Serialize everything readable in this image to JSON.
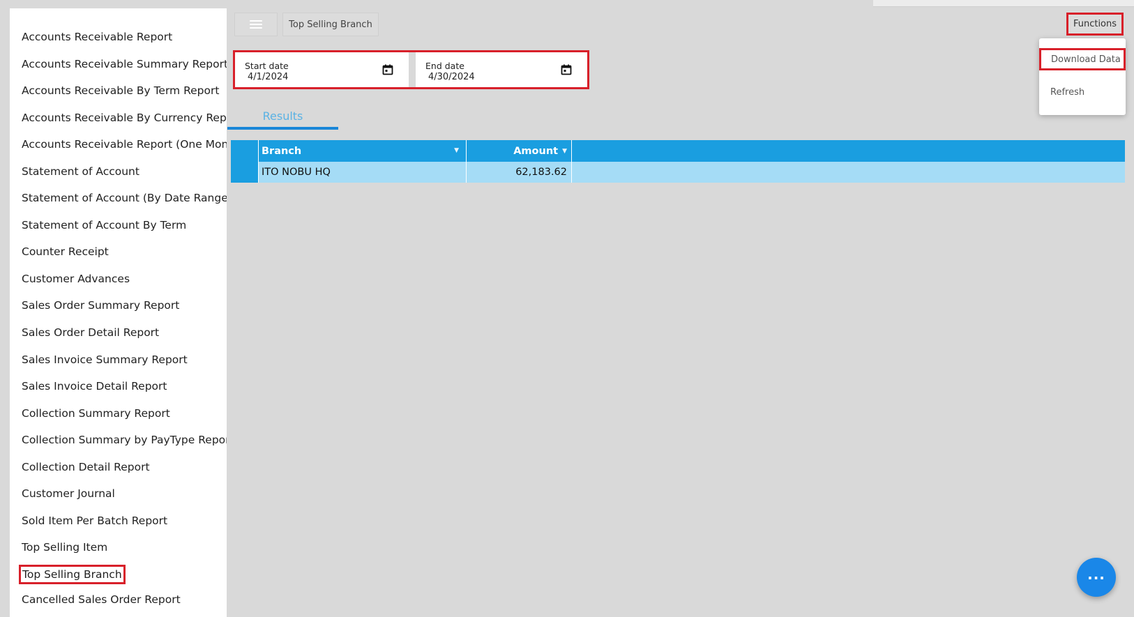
{
  "sidebar": {
    "items": [
      {
        "label": "Accounts Receivable Report"
      },
      {
        "label": "Accounts Receivable Summary Report"
      },
      {
        "label": "Accounts Receivable By Term Report"
      },
      {
        "label": "Accounts Receivable By Currency Report"
      },
      {
        "label": "Accounts Receivable Report (One Month)"
      },
      {
        "label": "Statement of Account"
      },
      {
        "label": "Statement of Account (By Date Range)"
      },
      {
        "label": "Statement of Account By Term"
      },
      {
        "label": "Counter Receipt"
      },
      {
        "label": "Customer Advances"
      },
      {
        "label": "Sales Order Summary Report"
      },
      {
        "label": "Sales Order Detail Report"
      },
      {
        "label": "Sales Invoice Summary Report"
      },
      {
        "label": "Sales Invoice Detail Report"
      },
      {
        "label": "Collection Summary Report"
      },
      {
        "label": "Collection Summary by PayType Report"
      },
      {
        "label": "Collection Detail Report"
      },
      {
        "label": "Customer Journal"
      },
      {
        "label": "Sold Item Per Batch Report"
      },
      {
        "label": "Top Selling Item"
      },
      {
        "label": "Top Selling Branch"
      },
      {
        "label": "Cancelled Sales Order Report"
      }
    ],
    "active_index": 20
  },
  "header": {
    "title": "Top Selling Branch",
    "functions_label": "Functions"
  },
  "functions_menu": {
    "download_label": "Download Data",
    "refresh_label": "Refresh"
  },
  "filters": {
    "start_label": "Start date",
    "start_value": "4/1/2024",
    "end_label": "End date",
    "end_value": "4/30/2024"
  },
  "tabs": [
    {
      "label": "Results",
      "active": true
    }
  ],
  "table": {
    "columns": [
      "Branch",
      "Amount"
    ],
    "rows": [
      {
        "branch": "ITO NOBU HQ",
        "amount": "62,183.62"
      }
    ]
  },
  "colors": {
    "accent": "#1a9ee0",
    "highlight": "#d8202a",
    "row_selected": "#a5dcf6",
    "fab": "#1a87e8"
  },
  "icons": {
    "menu": "hamburger-icon",
    "calendar": "calendar-icon",
    "filter": "filter-icon",
    "more": "more-dots-icon"
  }
}
